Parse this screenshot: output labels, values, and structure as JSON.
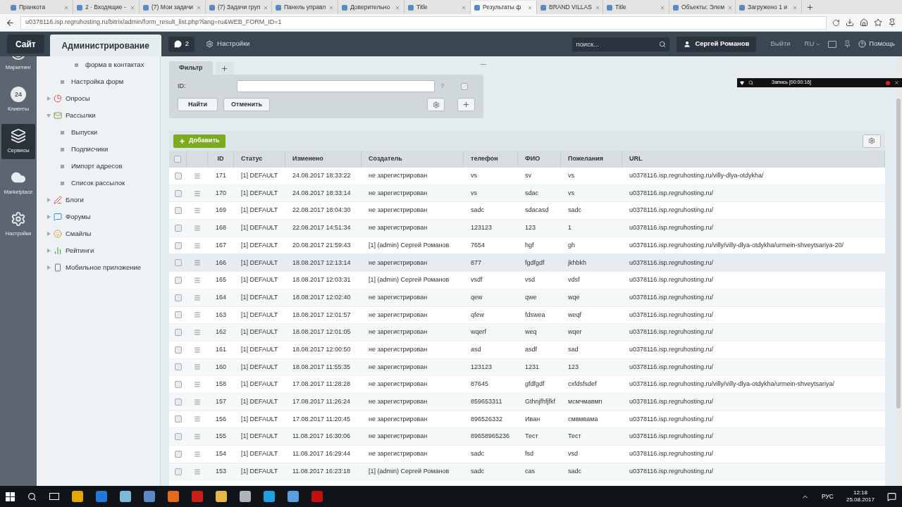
{
  "browser": {
    "tabs": [
      {
        "title": "Пранкота",
        "selected": false
      },
      {
        "title": "2 · Входящие -",
        "selected": false
      },
      {
        "title": "(7) Мои задачи",
        "selected": false
      },
      {
        "title": "(7) Задачи груп",
        "selected": false
      },
      {
        "title": "Панель управл",
        "selected": false
      },
      {
        "title": "Доверительно",
        "selected": false
      },
      {
        "title": "Title",
        "selected": false
      },
      {
        "title": "Результаты ф",
        "selected": true
      },
      {
        "title": "BRAND VILLAS",
        "selected": false
      },
      {
        "title": "Title",
        "selected": false
      },
      {
        "title": "Объекты: Элем",
        "selected": false
      },
      {
        "title": "Загружено 1 и",
        "selected": false
      }
    ],
    "address": "u0378116.isp.regruhosting.ru/bitrix/admin/form_result_list.php?lang=ru&WEB_FORM_ID=1"
  },
  "header": {
    "site_button": "Сайт",
    "admin_tab": "Администрирование",
    "notifications": "2",
    "settings": "Настройки",
    "search_placeholder": "поиск...",
    "user": "Сергей Романов",
    "logout": "Выйти",
    "language": "RU",
    "help": "Помощь"
  },
  "recorder": {
    "label": "Запись [00:00:16]"
  },
  "icon_strip": [
    {
      "label": "Маркетинг",
      "selected": false
    },
    {
      "label": "Клиенты",
      "icon_text": "24",
      "selected": false
    },
    {
      "label": "Сервисы",
      "selected": true
    },
    {
      "label": "Marketplace",
      "selected": false
    },
    {
      "label": "Настройки",
      "selected": false
    }
  ],
  "tree": [
    {
      "kind": "subleaf",
      "label": "форма в контактах"
    },
    {
      "kind": "leaf",
      "label": "Настройка форм"
    },
    {
      "kind": "section",
      "label": "Опросы",
      "expanded": false
    },
    {
      "kind": "section",
      "label": "Рассылки",
      "expanded": true,
      "children": [
        {
          "kind": "leaf",
          "label": "Выпуски"
        },
        {
          "kind": "leaf",
          "label": "Подписчики"
        },
        {
          "kind": "leaf",
          "label": "Импорт адресов"
        },
        {
          "kind": "leaf",
          "label": "Список рассылок"
        }
      ]
    },
    {
      "kind": "section",
      "label": "Блоги",
      "expanded": false
    },
    {
      "kind": "section",
      "label": "Форумы",
      "expanded": false
    },
    {
      "kind": "section",
      "label": "Смайлы",
      "expanded": false
    },
    {
      "kind": "section",
      "label": "Рейтинги",
      "expanded": false
    },
    {
      "kind": "section",
      "label": "Мобильное приложение",
      "expanded": false
    }
  ],
  "filter": {
    "tab": "Фильтр",
    "field_label": "ID:",
    "help": "?",
    "checked": false,
    "find_button": "Найти",
    "cancel_button": "Отменить"
  },
  "add_button": "Добавить",
  "table": {
    "all_checked": false,
    "columns": [
      "ID",
      "Статус",
      "Изменено",
      "Создатель",
      "телефон",
      "ФИО",
      "Пожелания",
      "URL"
    ],
    "rows": [
      {
        "checked": false,
        "hovered": false,
        "cells": [
          "171",
          "[1] DEFAULT",
          "24.08.2017 18:33:22",
          "не зарегистрирован",
          "vs",
          "sv",
          "vs",
          "u0378116.isp.regruhosting.ru/villy-dlya-otdykha/"
        ]
      },
      {
        "checked": false,
        "hovered": false,
        "cells": [
          "170",
          "[1] DEFAULT",
          "24.08.2017 18:33:14",
          "не зарегистрирован",
          "vs",
          "sdac",
          "vs",
          "u0378116.isp.regruhosting.ru/"
        ]
      },
      {
        "checked": false,
        "hovered": false,
        "cells": [
          "169",
          "[1] DEFAULT",
          "22.08.2017 18:04:30",
          "не зарегистрирован",
          "sadc",
          "sdacasd",
          "sadc",
          "u0378116.isp.regruhosting.ru/"
        ]
      },
      {
        "checked": false,
        "hovered": false,
        "cells": [
          "168",
          "[1] DEFAULT",
          "22.08.2017 14:51:34",
          "не зарегистрирован",
          "123123",
          "123",
          "1",
          "u0378116.isp.regruhosting.ru/"
        ]
      },
      {
        "checked": false,
        "hovered": false,
        "cells": [
          "167",
          "[1] DEFAULT",
          "20.08.2017 21:59:43",
          "[1] (admin) Сергей Романов",
          "7654",
          "hgf",
          "gh",
          "u0378116.isp.regruhosting.ru/villy/villy-dlya-otdykha/urmein-shveytsariya-20/"
        ]
      },
      {
        "checked": false,
        "hovered": true,
        "cells": [
          "166",
          "[1] DEFAULT",
          "18.08.2017 12:13:14",
          "не зарегистрирован",
          "877",
          "fgdfgdf",
          "jkhbkh",
          "u0378116.isp.regruhosting.ru/"
        ]
      },
      {
        "checked": false,
        "hovered": false,
        "cells": [
          "165",
          "[1] DEFAULT",
          "18.08.2017 12:03:31",
          "[1] (admin) Сергей Романов",
          "vsdf",
          "vsd",
          "vdsf",
          "u0378116.isp.regruhosting.ru/"
        ]
      },
      {
        "checked": false,
        "hovered": false,
        "cells": [
          "164",
          "[1] DEFAULT",
          "18.08.2017 12:02:40",
          "не зарегистрирован",
          "qew",
          "qwe",
          "wqe",
          "u0378116.isp.regruhosting.ru/"
        ]
      },
      {
        "checked": false,
        "hovered": false,
        "cells": [
          "163",
          "[1] DEFAULT",
          "18.08.2017 12:01:57",
          "не зарегистрирован",
          "qfew",
          "fdswea",
          "weqf",
          "u0378116.isp.regruhosting.ru/"
        ]
      },
      {
        "checked": false,
        "hovered": false,
        "cells": [
          "162",
          "[1] DEFAULT",
          "18.08.2017 12:01:05",
          "не зарегистрирован",
          "wqerf",
          "weq",
          "wqer",
          "u0378116.isp.regruhosting.ru/"
        ]
      },
      {
        "checked": false,
        "hovered": false,
        "cells": [
          "161",
          "[1] DEFAULT",
          "18.08.2017 12:00:50",
          "не зарегистрирован",
          "asd",
          "asdf",
          "sad",
          "u0378116.isp.regruhosting.ru/"
        ]
      },
      {
        "checked": false,
        "hovered": false,
        "cells": [
          "160",
          "[1] DEFAULT",
          "18.08.2017 11:55:35",
          "не зарегистрирован",
          "123123",
          "1231",
          "123",
          "u0378116.isp.regruhosting.ru/"
        ]
      },
      {
        "checked": false,
        "hovered": false,
        "cells": [
          "158",
          "[1] DEFAULT",
          "17.08.2017 11:28:28",
          "не зарегистрирован",
          "87645",
          "gfdfgdf",
          "cxfdsfsdef",
          "u0378116.isp.regruhosting.ru/villy/villy-dlya-otdykha/urmein-shveytsariya/"
        ]
      },
      {
        "checked": false,
        "hovered": false,
        "cells": [
          "157",
          "[1] DEFAULT",
          "17.08.2017 11:26:24",
          "не зарегистрирован",
          "859653311",
          "Gthnjfhfjfkf",
          "мсмчмавмп",
          "u0378116.isp.regruhosting.ru/"
        ]
      },
      {
        "checked": false,
        "hovered": false,
        "cells": [
          "156",
          "[1] DEFAULT",
          "17.08.2017 11:20:45",
          "не зарегистрирован",
          "896526332",
          "Иван",
          "смвмвама",
          "u0378116.isp.regruhosting.ru/"
        ]
      },
      {
        "checked": false,
        "hovered": false,
        "cells": [
          "155",
          "[1] DEFAULT",
          "11.08.2017 16:30:06",
          "не зарегистрирован",
          "89658965236",
          "Тест",
          "Тест",
          "u0378116.isp.regruhosting.ru/"
        ]
      },
      {
        "checked": false,
        "hovered": false,
        "cells": [
          "154",
          "[1] DEFAULT",
          "11.08.2017 16:29:44",
          "не зарегистрирован",
          "sadc",
          "fsd",
          "vsd",
          "u0378116.isp.regruhosting.ru/"
        ]
      },
      {
        "checked": false,
        "hovered": false,
        "cells": [
          "153",
          "[1] DEFAULT",
          "11.08.2017 16:23:18",
          "[1] (admin) Сергей Романов",
          "sadc",
          "cas",
          "sadc",
          "u0378116.isp.regruhosting.ru/"
        ]
      }
    ]
  },
  "taskbar": {
    "language": "РУС",
    "time": "12:18",
    "date": "25.08.2017"
  }
}
